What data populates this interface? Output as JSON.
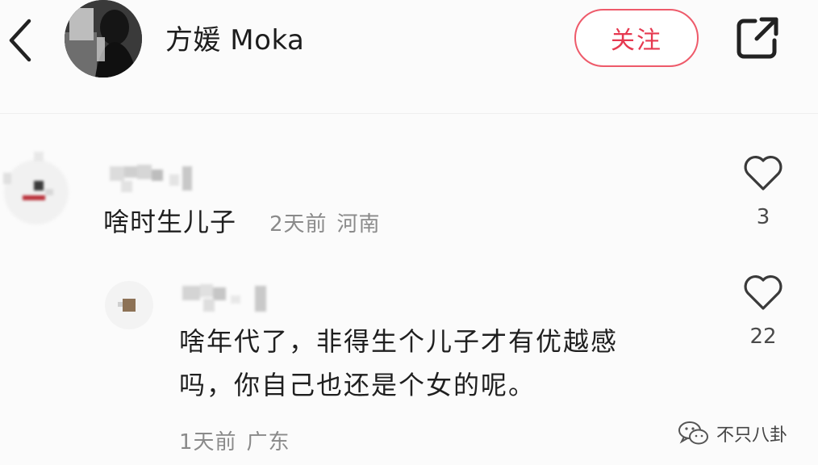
{
  "header": {
    "username": "方媛 Moka",
    "follow_label": "关注"
  },
  "comments": [
    {
      "text": "啥时生儿子",
      "time": "2天前",
      "location": "河南",
      "likes": "3"
    },
    {
      "text": "啥年代了，非得生个儿子才有优越感\n吗，你自己也还是个女的呢。",
      "time": "1天前",
      "location": "广东",
      "likes": "22"
    }
  ],
  "watermark": {
    "text": "不只八卦"
  },
  "icons": {
    "back": "chevron-left-icon",
    "share": "share-icon",
    "like": "heart-icon",
    "watermark": "wechat-icon"
  },
  "colors": {
    "accent": "#e63950",
    "meta": "#8a8a8a"
  }
}
